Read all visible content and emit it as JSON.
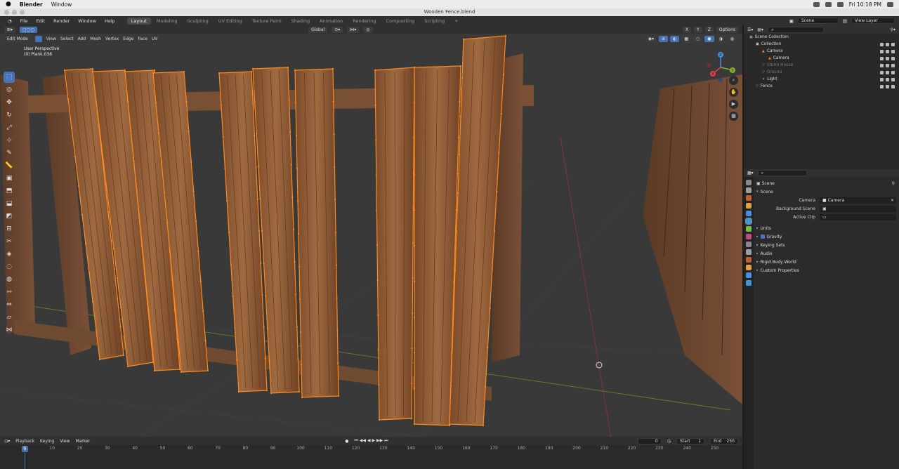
{
  "macos": {
    "app_name": "Blender",
    "menu": [
      "Window"
    ],
    "clock": "Fri 10:18 PM"
  },
  "window_title": "Wooden Fence.blend",
  "topbar": {
    "menus": [
      "File",
      "Edit",
      "Render",
      "Window",
      "Help"
    ],
    "workspaces": [
      {
        "label": "Layout",
        "active": true
      },
      {
        "label": "Modeling",
        "active": false
      },
      {
        "label": "Sculpting",
        "active": false
      },
      {
        "label": "UV Editing",
        "active": false
      },
      {
        "label": "Texture Paint",
        "active": false
      },
      {
        "label": "Shading",
        "active": false
      },
      {
        "label": "Animation",
        "active": false
      },
      {
        "label": "Rendering",
        "active": false
      },
      {
        "label": "Compositing",
        "active": false
      },
      {
        "label": "Scripting",
        "active": false
      }
    ],
    "add_tab": "+",
    "scene_field": "Scene",
    "view_layer_field": "View Layer"
  },
  "viewport": {
    "transform_orientation": "Global",
    "options_label": "Options",
    "axis_labels": [
      "X",
      "Y",
      "Z"
    ],
    "mode": "Edit Mode",
    "menus": [
      "View",
      "Select",
      "Add",
      "Mesh",
      "Vertex",
      "Edge",
      "Face",
      "UV"
    ],
    "info_line1": "User Perspective",
    "info_line2": "(0) Plank.038",
    "tools": [
      "select-box",
      "cursor",
      "move",
      "rotate",
      "scale",
      "transform",
      "annotate",
      "measure",
      "add-cube",
      "extrude",
      "inset",
      "bevel",
      "loop-cut",
      "knife",
      "poly-build",
      "spin",
      "smooth",
      "edge-slide",
      "shrink-fatten",
      "shear",
      "rip"
    ],
    "gizmo_axes": {
      "x": "X",
      "y": "Y",
      "z": "Z"
    },
    "colors": {
      "selection": "#ff8a1f",
      "wood": "#8a5a35",
      "background": "#393939"
    }
  },
  "timeline": {
    "menus": [
      "Playback",
      "Keying",
      "View",
      "Marker"
    ],
    "current_frame": "0",
    "start_label": "Start",
    "start_value": "1",
    "end_label": "End",
    "end_value": "250",
    "ruler": [
      "0",
      "10",
      "20",
      "30",
      "40",
      "50",
      "60",
      "70",
      "80",
      "90",
      "100",
      "110",
      "120",
      "130",
      "140",
      "150",
      "160",
      "170",
      "180",
      "190",
      "200",
      "210",
      "220",
      "230",
      "240",
      "250"
    ]
  },
  "outliner": {
    "title": "Scene Collection",
    "rows": [
      {
        "label": "Collection",
        "indent": 1,
        "dim": false,
        "selected": false
      },
      {
        "label": "Camera",
        "indent": 2,
        "dim": false,
        "selected": false
      },
      {
        "label": "Camera",
        "indent": 3,
        "dim": false,
        "selected": false
      },
      {
        "label": "Storm House",
        "indent": 2,
        "dim": true,
        "selected": false
      },
      {
        "label": "Ground",
        "indent": 2,
        "dim": true,
        "selected": false
      },
      {
        "label": "Light",
        "indent": 2,
        "dim": false,
        "selected": false
      },
      {
        "label": "Fence",
        "indent": 1,
        "dim": false,
        "selected": false
      }
    ]
  },
  "properties": {
    "breadcrumb": "Scene",
    "section": "Scene",
    "camera_label": "Camera",
    "camera_value": "Camera",
    "background_scene_label": "Background Scene",
    "active_clip_label": "Active Clip",
    "subsections": [
      {
        "label": "Units",
        "checkbox": false
      },
      {
        "label": "Gravity",
        "checkbox": true
      },
      {
        "label": "Keying Sets",
        "checkbox": false
      },
      {
        "label": "Audio",
        "checkbox": false
      },
      {
        "label": "Rigid Body World",
        "checkbox": false
      },
      {
        "label": "Custom Properties",
        "checkbox": false
      }
    ],
    "tab_colors": [
      "#888888",
      "#a0a0a0",
      "#c06030",
      "#e0a040",
      "#4c8ce0",
      "#3a9ad8",
      "#6fc04a",
      "#c04a7a"
    ]
  }
}
